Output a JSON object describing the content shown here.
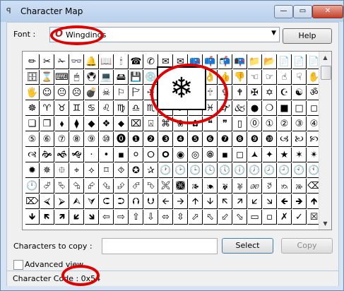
{
  "title": "Character Map",
  "title_icon": "character-map-icon",
  "window_buttons": {
    "minimize": "—",
    "maximize": "▭",
    "close": "✕"
  },
  "font": {
    "label": "Font :",
    "value": "Wingdings",
    "icon_glyph": "O"
  },
  "help_label": "Help",
  "grid_rows": [
    [
      "✏",
      "✂",
      "✁",
      "👓",
      "🔔",
      "📖",
      "🕯",
      "☎",
      "✆",
      "✉",
      "✉",
      "📪",
      "📫",
      "📬",
      "📭",
      "📁",
      "📂",
      "📄",
      "📄",
      "📄"
    ],
    [
      "🗄",
      "⌛",
      "⌨",
      "🖱",
      "🖲",
      "💻",
      "🖴",
      "💾",
      "💿",
      "✍",
      "✍",
      "✌",
      "👌",
      "👍",
      "👎",
      "☜",
      "☞",
      "☝",
      "☟",
      "✋"
    ],
    [
      "🖐",
      "☺",
      "😐",
      "☹",
      "💣",
      "☠",
      "⚐",
      "🏱",
      "✈",
      "☼",
      "💧",
      "❄",
      "🕆",
      "✞",
      "🕈",
      "✠",
      "✡",
      "☪",
      "☯",
      "ॐ"
    ],
    [
      "☸",
      "♈",
      "♉",
      "♊",
      "♋",
      "♌",
      "♍",
      "♎",
      "♏",
      "♐",
      "♑",
      "♒",
      "♓",
      "🙰",
      "🙵",
      "●",
      "❍",
      "■",
      "□",
      "◻"
    ],
    [
      "❑",
      "❒",
      "⬧",
      "⧫",
      "◆",
      "❖",
      "⬥",
      "⌧",
      "⍓",
      "⌘",
      "❀",
      "✿",
      "❝",
      "❞",
      "▯",
      "⓪",
      "①",
      "②",
      "③",
      "④"
    ],
    [
      "⑤",
      "⑥",
      "⑦",
      "⑧",
      "⑨",
      "⑩",
      "⓿",
      "❶",
      "❷",
      "❸",
      "❹",
      "❺",
      "❻",
      "❼",
      "❽",
      "❾",
      "❿",
      "🙢",
      "🙠",
      "🙡"
    ],
    [
      "🙣",
      "🙞",
      "🙜",
      "🙝",
      "·",
      "•",
      "▪",
      "⚪",
      "🞆",
      "🞈",
      "◉",
      "◎",
      "🞋",
      "▪",
      "◻",
      "🟂",
      "✦",
      "★",
      "✶",
      "✴"
    ],
    [
      "✹",
      "✵",
      "⯐",
      "⌖",
      "⟡",
      "⌑",
      "⯑",
      "✪",
      "✰",
      "🕐",
      "🕑",
      "🕒",
      "🕓",
      "🕔",
      "🕕",
      "🕖",
      "🕗",
      "🕘",
      "🕙",
      "🕚"
    ],
    [
      "🕛",
      "⮰",
      "⮱",
      "⮲",
      "⮳",
      "⮴",
      "⮵",
      "⮶",
      "⮷",
      "🙪",
      "🙫",
      "🙕",
      "🙔",
      "🙗",
      "🙖",
      "🙐",
      "🙑",
      "🙒",
      "🙓",
      "⌫"
    ],
    [
      "⌦",
      "⮘",
      "⮚",
      "⮙",
      "⮛",
      "⮈",
      "⮊",
      "⮉",
      "⮋",
      "🡨",
      "🡪",
      "🡩",
      "🡫",
      "🡬",
      "🡭",
      "🡯",
      "🡮",
      "🡸",
      "🡺",
      "🡹"
    ],
    [
      "🡻",
      "🡼",
      "🡽",
      "🡿",
      "🡾",
      "⇦",
      "⇨",
      "⇧",
      "⇩",
      "⬄",
      "⇳",
      "⬀",
      "⬁",
      "⬃",
      "⬂",
      "▭",
      "▫",
      "✗",
      "✓",
      "☒"
    ]
  ],
  "zoomed_char": "❄",
  "copy": {
    "label": "Characters to copy :",
    "value": "",
    "select_label": "Select",
    "copy_label": "Copy"
  },
  "advanced_view_label": "Advanced view",
  "status": "Character Code : 0x54"
}
